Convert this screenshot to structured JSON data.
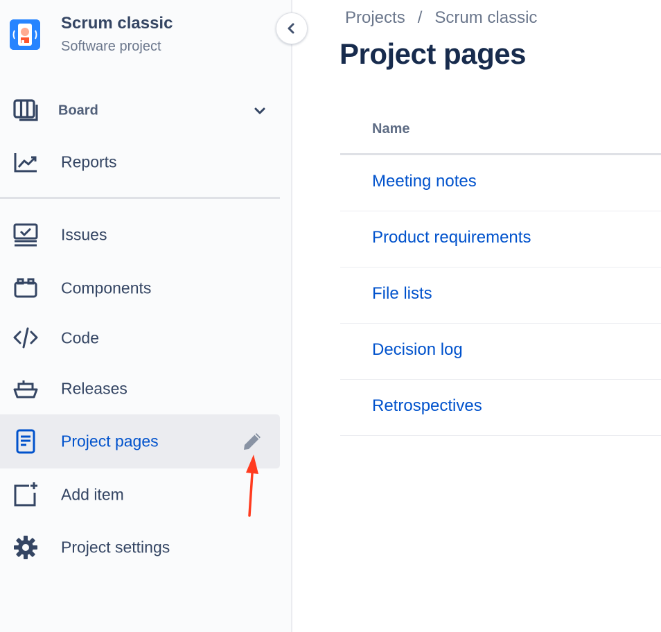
{
  "project": {
    "name": "Scrum classic",
    "type": "Software project"
  },
  "sidebar": {
    "items": [
      {
        "label": "Board",
        "icon": "board-icon"
      },
      {
        "label": "Reports",
        "icon": "reports-icon"
      },
      {
        "label": "Issues",
        "icon": "issues-icon"
      },
      {
        "label": "Components",
        "icon": "components-icon"
      },
      {
        "label": "Code",
        "icon": "code-icon"
      },
      {
        "label": "Releases",
        "icon": "releases-icon"
      },
      {
        "label": "Project pages",
        "icon": "page-icon",
        "selected": true
      },
      {
        "label": "Add item",
        "icon": "add-item-icon"
      },
      {
        "label": "Project settings",
        "icon": "gear-icon"
      }
    ]
  },
  "breadcrumb": {
    "items": [
      "Projects",
      "Scrum classic"
    ],
    "separator": "/"
  },
  "main": {
    "title": "Project pages",
    "table": {
      "header": "Name",
      "rows": [
        "Meeting notes",
        "Product requirements",
        "File lists",
        "Decision log",
        "Retrospectives"
      ]
    }
  },
  "colors": {
    "link": "#0052cc",
    "title": "#172b4d",
    "sidebar_bg": "#fafbfc",
    "selected_bg": "#ebecf0",
    "annotation_arrow": "#ff3b1f"
  }
}
